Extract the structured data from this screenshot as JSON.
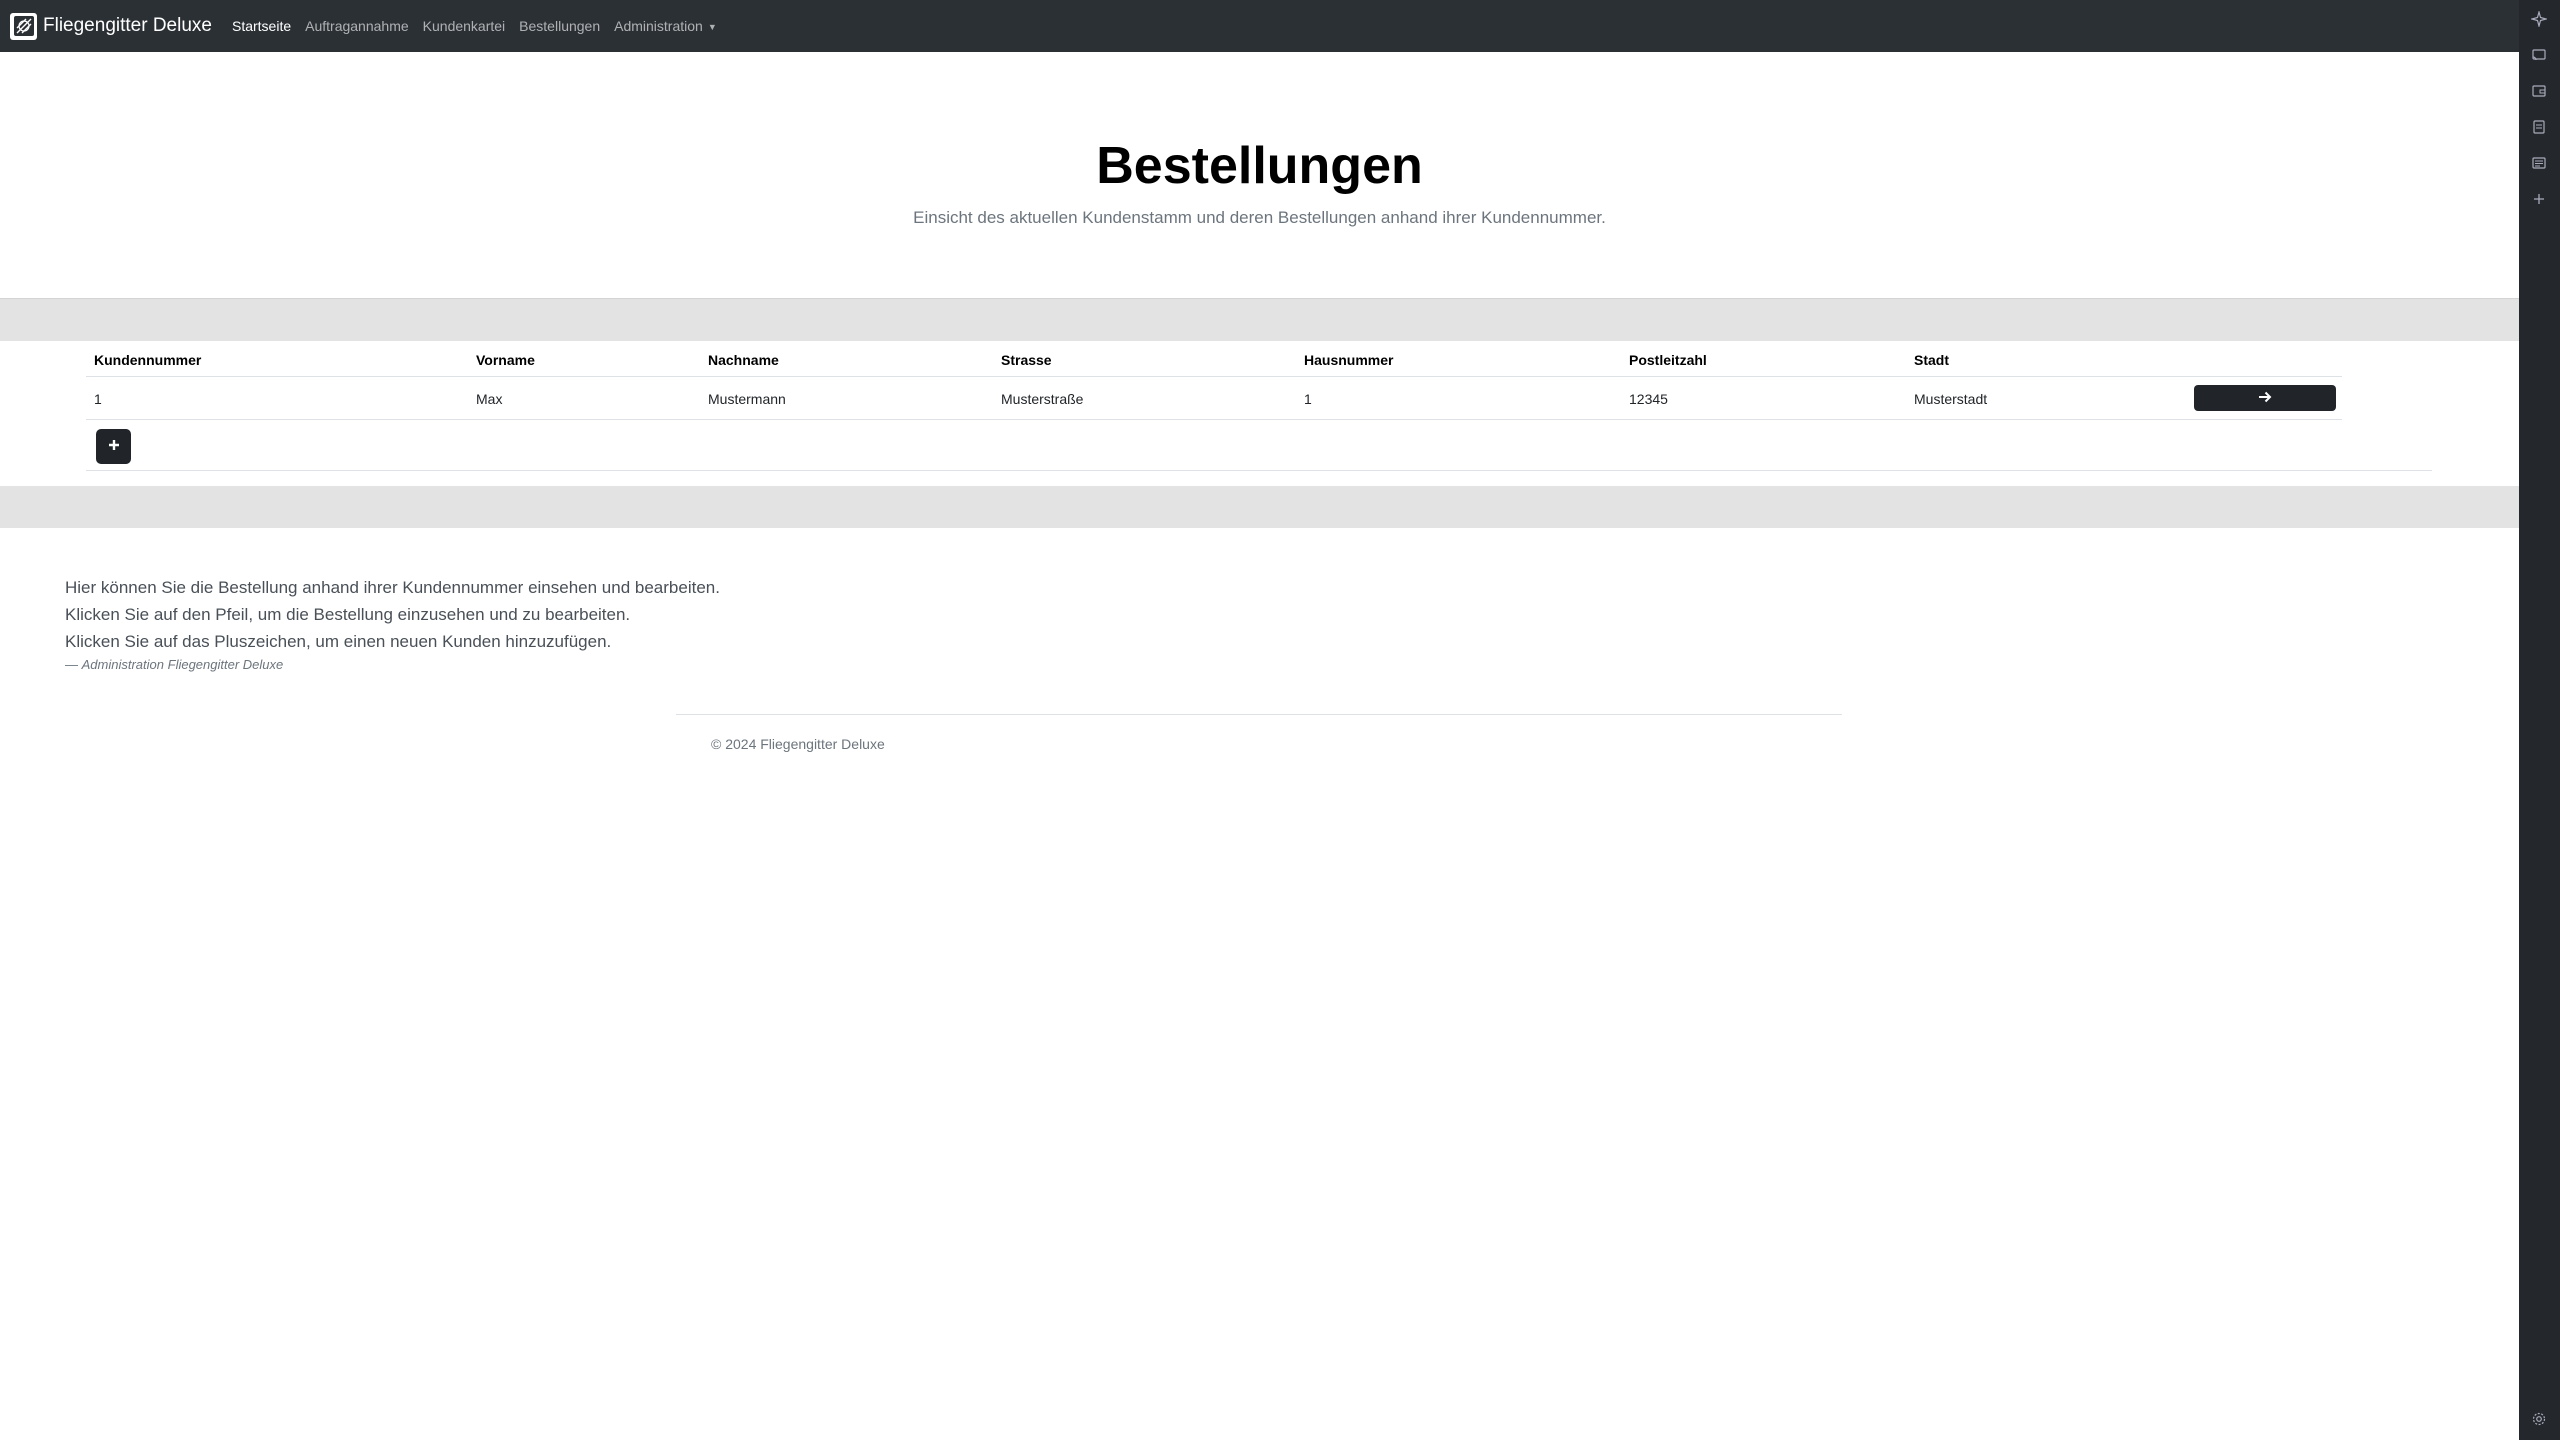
{
  "navbar": {
    "brand": "Fliegengitter Deluxe",
    "links": [
      "Startseite",
      "Auftragannahme",
      "Kundenkartei",
      "Bestellungen",
      "Administration"
    ]
  },
  "hero": {
    "title": "Bestellungen",
    "subtitle": "Einsicht des aktuellen Kundenstamm und deren Bestellungen anhand ihrer Kundennummer."
  },
  "table": {
    "headers": [
      "Kundennummer",
      "Vorname",
      "Nachname",
      "Strasse",
      "Hausnummer",
      "Postleitzahl",
      "Stadt"
    ],
    "rows": [
      [
        "1",
        "Max",
        "Mustermann",
        "Musterstraße",
        "1",
        "12345",
        "Musterstadt"
      ]
    ]
  },
  "info": {
    "lines": [
      "Hier können Sie die Bestellung anhand ihrer Kundennummer einsehen und bearbeiten.",
      "Klicken Sie auf den Pfeil, um die Bestellung einzusehen und zu bearbeiten.",
      "Klicken Sie auf das Pluszeichen, um einen neuen Kunden hinzuzufügen."
    ],
    "cite_prefix": "Administration",
    "cite_source": "Fliegengitter Deluxe"
  },
  "footer": {
    "text": "© 2024 Fliegengitter Deluxe"
  },
  "colors": {
    "navbar": "#2b3035",
    "button": "#212529",
    "band": "#e3e3e3"
  },
  "icons": {
    "brand": "net-logo-icon",
    "open_row": "arrow-right-icon",
    "add_customer": "plus-icon",
    "rail": [
      "sparkle-icon",
      "cast-icon",
      "wallet-icon",
      "save-icon",
      "reader-icon",
      "plus-icon",
      "gear-icon"
    ]
  }
}
